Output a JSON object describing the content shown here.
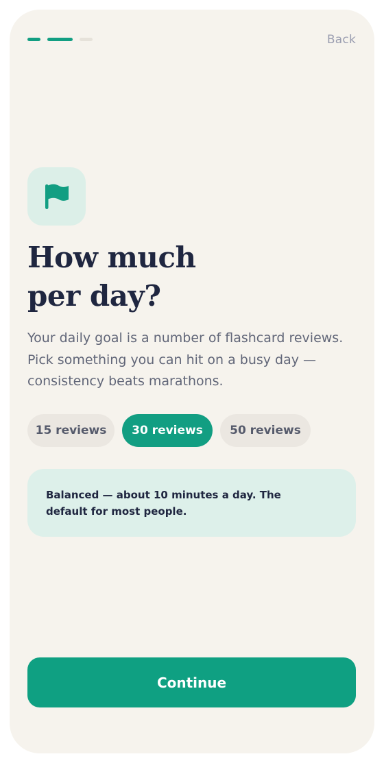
{
  "header": {
    "back_label": "Back",
    "progress": {
      "total_steps": 3,
      "current_step": 2
    }
  },
  "hero": {
    "icon": "flag-icon",
    "title_line1": "How much",
    "title_line2": "per day?",
    "description": "Your daily goal is a number of flashcard reviews. Pick something you can hit on a busy day — consistency beats marathons."
  },
  "options": [
    {
      "label": "15 reviews",
      "selected": false
    },
    {
      "label": "30 reviews",
      "selected": true
    },
    {
      "label": "50 reviews",
      "selected": false
    }
  ],
  "info": {
    "text": "Balanced — about 10 minutes a day. The default for most people."
  },
  "footer": {
    "continue_label": "Continue"
  },
  "colors": {
    "accent": "#129e82",
    "background": "#f6f3ed",
    "title": "#1f2640",
    "muted": "#9a9db0",
    "info_background": "#ddf0ea"
  }
}
